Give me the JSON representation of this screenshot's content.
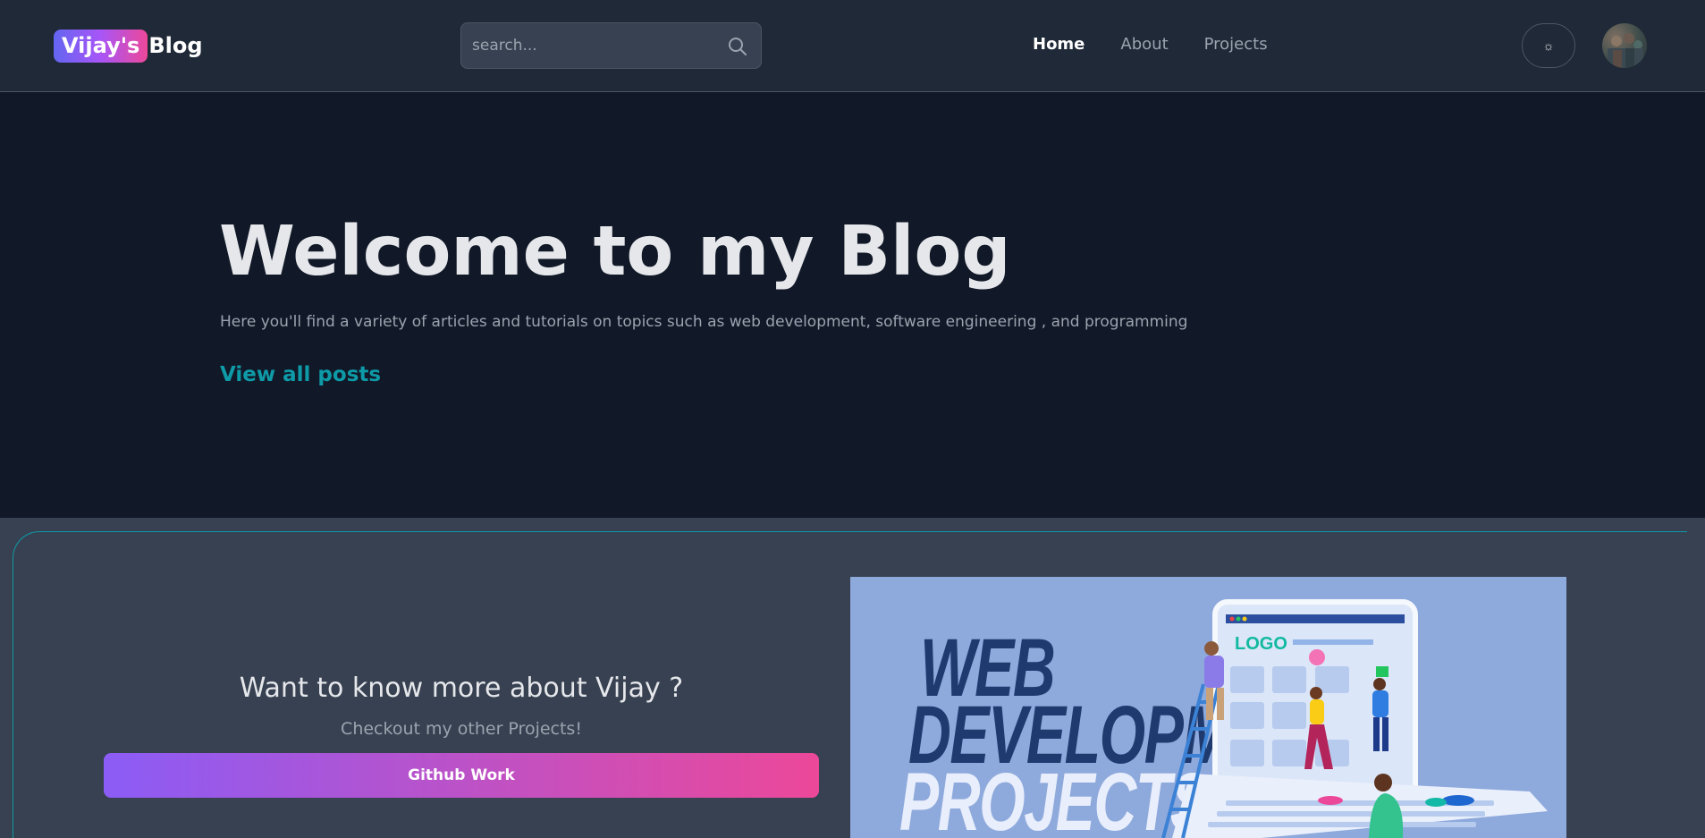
{
  "navbar": {
    "brand_highlight": "Vijay's",
    "brand_rest": "Blog",
    "search_placeholder": "search...",
    "links": [
      {
        "label": "Home",
        "active": true
      },
      {
        "label": "About",
        "active": false
      },
      {
        "label": "Projects",
        "active": false
      }
    ],
    "theme_toggle_icon": "sun-icon",
    "theme_toggle_glyph": "☼"
  },
  "hero": {
    "title": "Welcome to my Blog",
    "subtitle": "Here you'll find a variety of articles and tutorials on topics such as web development, software engineering , and programming",
    "cta_link": "View all posts"
  },
  "promo_card": {
    "title": "Want to know more about Vijay ?",
    "subtitle": "Checkout my other Projects!",
    "button_label": "Github Work",
    "image_text": [
      "WEB",
      "DEVELOPMENT",
      "PROJECTS"
    ],
    "image_sign_text": "LOGO"
  },
  "colors": {
    "page_bg": "#111827",
    "nav_bg": "#1f2937",
    "accent_teal": "#0e9aa7",
    "gradient_start": "#8b5cf6",
    "gradient_end": "#ec4899"
  }
}
